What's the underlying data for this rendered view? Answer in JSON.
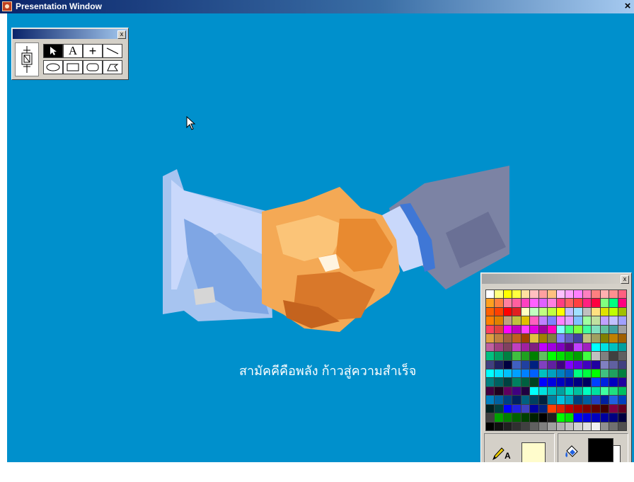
{
  "window": {
    "title": "Presentation Window",
    "close_glyph": "×"
  },
  "tool_palette": {
    "close_glyph": "x",
    "tools": [
      {
        "name": "arrow-pointer-icon",
        "selected": true
      },
      {
        "name": "text-tool-icon",
        "label": "A"
      },
      {
        "name": "crosshair-tool-icon",
        "label": "+"
      },
      {
        "name": "line-tool-icon"
      },
      {
        "name": "ellipse-tool-icon"
      },
      {
        "name": "rectangle-tool-icon"
      },
      {
        "name": "rounded-rectangle-tool-icon"
      },
      {
        "name": "polygon-tool-icon"
      }
    ]
  },
  "stage": {
    "background": "#0090cc",
    "image": "handshake-illustration",
    "slogan": "สามัคคีคือพลัง ก้าวสู่ความสำเร็จ"
  },
  "color_palette": {
    "close_glyph": "x",
    "text_color_tool": {
      "icon": "pencil-icon",
      "label": "A",
      "color": "#fffccc"
    },
    "fill_tool": {
      "icon": "paint-bucket-icon",
      "foreground": "#000000",
      "background": "#ffffff"
    },
    "swatches": [
      "#ffffff",
      "#ffff80",
      "#ffff00",
      "#ffff40",
      "#ffe0a0",
      "#ffc0c0",
      "#ffa0a0",
      "#ffc080",
      "#ffc0ff",
      "#ffa0ff",
      "#ff80ff",
      "#ff80c0",
      "#ff8080",
      "#ffb0b0",
      "#ff9090",
      "#ff6080",
      "#ffa020",
      "#ff8040",
      "#ff80a0",
      "#ff60a0",
      "#ff40c0",
      "#ff60ff",
      "#e060ff",
      "#ff80e0",
      "#ff4080",
      "#ff6060",
      "#ff4040",
      "#ff2080",
      "#ff0040",
      "#80ff80",
      "#00ff80",
      "#ff0080",
      "#ff6000",
      "#ff4000",
      "#ff0000",
      "#e02020",
      "#ffffc0",
      "#c0ffc0",
      "#c0ff80",
      "#c0ff40",
      "#ffff00",
      "#c0c0ff",
      "#a0e0ff",
      "#c0c0c0",
      "#ffe080",
      "#e0e000",
      "#c0ff00",
      "#a0c000",
      "#ff8000",
      "#e08000",
      "#c0a080",
      "#c0c040",
      "#e0c000",
      "#ff60c0",
      "#c080ff",
      "#8080ff",
      "#ff80ff",
      "#e0a0ff",
      "#80c0ff",
      "#a0ffa0",
      "#c0e0a0",
      "#c0a0ff",
      "#c0c0ff",
      "#a0a0ff",
      "#ff4060",
      "#e04040",
      "#ff00ff",
      "#c000c0",
      "#ff40ff",
      "#e000e0",
      "#a000a0",
      "#ff00c0",
      "#80ffff",
      "#40ff80",
      "#80ff40",
      "#40ffa0",
      "#80e0c0",
      "#60c0a0",
      "#40a0a0",
      "#a0a0a0",
      "#e0a040",
      "#c08040",
      "#a06040",
      "#c06020",
      "#a04000",
      "#e0c040",
      "#a08000",
      "#808040",
      "#8080ff",
      "#6060c0",
      "#4040a0",
      "#c0c080",
      "#a0a060",
      "#808000",
      "#c08000",
      "#a06000",
      "#c060a0",
      "#a04080",
      "#804060",
      "#c040c0",
      "#a020a0",
      "#802080",
      "#c000ff",
      "#a000e0",
      "#8000c0",
      "#600080",
      "#c040ff",
      "#a020c0",
      "#00ffff",
      "#00e0e0",
      "#00c0c0",
      "#00a0a0",
      "#00c080",
      "#00a060",
      "#008040",
      "#40c040",
      "#20a020",
      "#008000",
      "#60c060",
      "#00ff00",
      "#00e000",
      "#00c000",
      "#00a000",
      "#40ff40",
      "#c0c0c0",
      "#808080",
      "#404040",
      "#606060",
      "#404080",
      "#202060",
      "#000040",
      "#4060c0",
      "#2040a0",
      "#002080",
      "#8040c0",
      "#6020a0",
      "#400080",
      "#8000ff",
      "#6000e0",
      "#4000c0",
      "#2000a0",
      "#8080c0",
      "#6060a0",
      "#404080",
      "#00ffff",
      "#00e0ff",
      "#00c0ff",
      "#00a0ff",
      "#0080ff",
      "#0060ff",
      "#00c0c0",
      "#00a0c0",
      "#0080c0",
      "#0060c0",
      "#00ff80",
      "#00ff40",
      "#00ff00",
      "#40c080",
      "#20a060",
      "#008040",
      "#008080",
      "#006060",
      "#004040",
      "#008060",
      "#006040",
      "#004020",
      "#0000ff",
      "#0000e0",
      "#0000c0",
      "#0000a0",
      "#000080",
      "#000060",
      "#0040ff",
      "#0020e0",
      "#0000c0",
      "#2000a0",
      "#400040",
      "#200020",
      "#600060",
      "#400080",
      "#200040",
      "#00ffff",
      "#00e0e0",
      "#00c0c0",
      "#00a0a0",
      "#00e0c0",
      "#00c0a0",
      "#00ffc0",
      "#00e0a0",
      "#40ffa0",
      "#20e080",
      "#00c060",
      "#0080c0",
      "#0060a0",
      "#004080",
      "#002060",
      "#006080",
      "#004060",
      "#002040",
      "#0080a0",
      "#00c0e0",
      "#00a0c0",
      "#004080",
      "#0060a0",
      "#2040c0",
      "#0020a0",
      "#2060e0",
      "#0040c0",
      "#002020",
      "#004040",
      "#0000ff",
      "#2020e0",
      "#4040c0",
      "#0000a0",
      "#002080",
      "#ff4000",
      "#e02000",
      "#c00000",
      "#a00000",
      "#800000",
      "#600000",
      "#400000",
      "#800040",
      "#600020",
      "#404040",
      "#00a000",
      "#008000",
      "#006000",
      "#004000",
      "#002000",
      "#000000",
      "#202020",
      "#00ff00",
      "#00e000",
      "#0000ff",
      "#0000e0",
      "#0000c0",
      "#0000a0",
      "#000080",
      "#000040",
      "#000000",
      "#101010",
      "#202020",
      "#303030",
      "#404040",
      "#606060",
      "#808080",
      "#a0a0a0",
      "#b0b0b0",
      "#c0c0c0",
      "#d0d0d0",
      "#e0e0e0",
      "#f0f0f0",
      "#909090",
      "#707070",
      "#505050"
    ]
  }
}
